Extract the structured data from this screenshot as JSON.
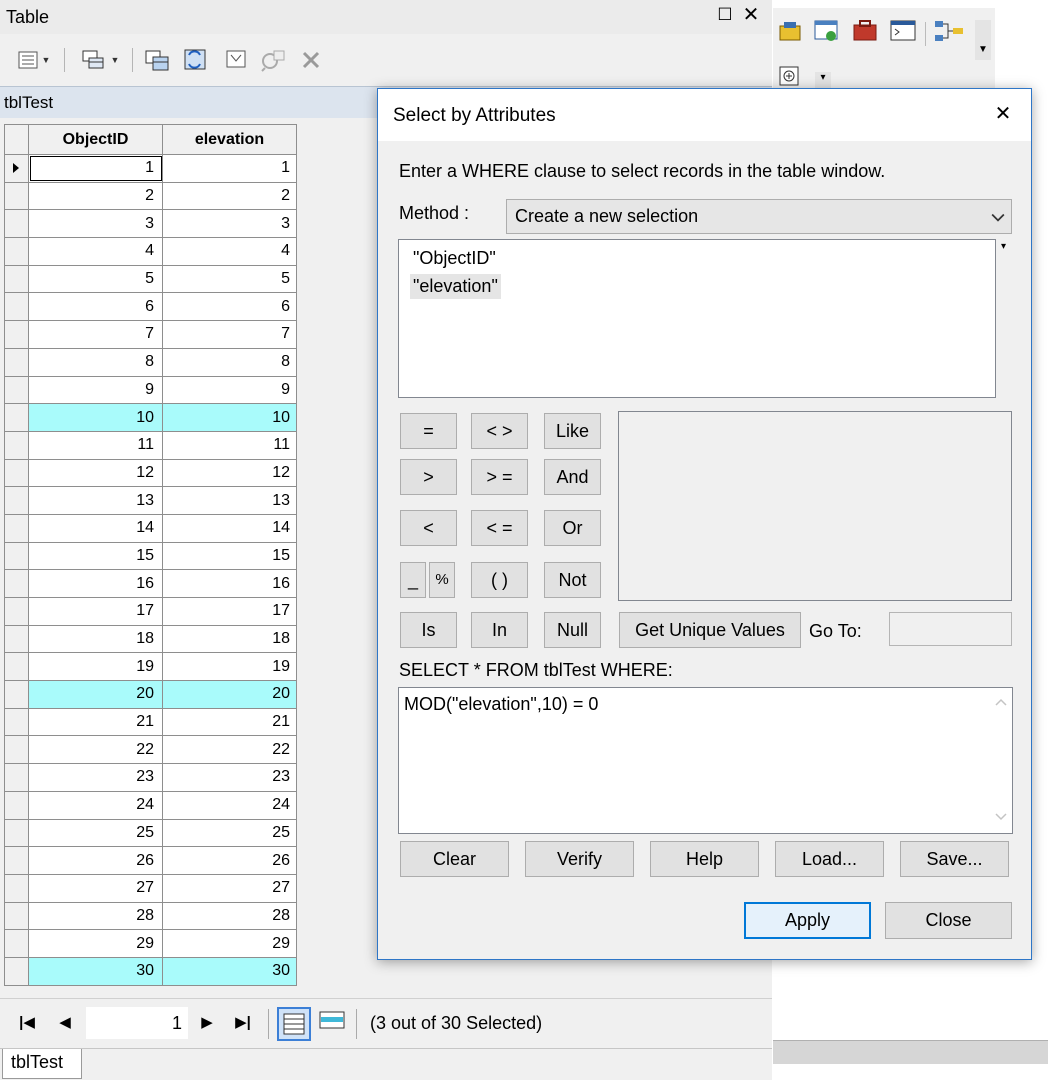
{
  "table_window": {
    "title": "Table",
    "table_name": "tblTest",
    "columns": [
      "ObjectID",
      "elevation"
    ],
    "rows": [
      {
        "objectid": "1",
        "elevation": "1"
      },
      {
        "objectid": "2",
        "elevation": "2"
      },
      {
        "objectid": "3",
        "elevation": "3"
      },
      {
        "objectid": "4",
        "elevation": "4"
      },
      {
        "objectid": "5",
        "elevation": "5"
      },
      {
        "objectid": "6",
        "elevation": "6"
      },
      {
        "objectid": "7",
        "elevation": "7"
      },
      {
        "objectid": "8",
        "elevation": "8"
      },
      {
        "objectid": "9",
        "elevation": "9"
      },
      {
        "objectid": "10",
        "elevation": "10"
      },
      {
        "objectid": "11",
        "elevation": "11"
      },
      {
        "objectid": "12",
        "elevation": "12"
      },
      {
        "objectid": "13",
        "elevation": "13"
      },
      {
        "objectid": "14",
        "elevation": "14"
      },
      {
        "objectid": "15",
        "elevation": "15"
      },
      {
        "objectid": "16",
        "elevation": "16"
      },
      {
        "objectid": "17",
        "elevation": "17"
      },
      {
        "objectid": "18",
        "elevation": "18"
      },
      {
        "objectid": "19",
        "elevation": "19"
      },
      {
        "objectid": "20",
        "elevation": "20"
      },
      {
        "objectid": "21",
        "elevation": "21"
      },
      {
        "objectid": "22",
        "elevation": "22"
      },
      {
        "objectid": "23",
        "elevation": "23"
      },
      {
        "objectid": "24",
        "elevation": "24"
      },
      {
        "objectid": "25",
        "elevation": "25"
      },
      {
        "objectid": "26",
        "elevation": "26"
      },
      {
        "objectid": "27",
        "elevation": "27"
      },
      {
        "objectid": "28",
        "elevation": "28"
      },
      {
        "objectid": "29",
        "elevation": "29"
      },
      {
        "objectid": "30",
        "elevation": "30"
      }
    ],
    "selected_rows": [
      "10",
      "20",
      "30"
    ],
    "current_row": "1",
    "current_record": "1",
    "selection_summary": "(3 out of 30 Selected)",
    "bottom_tab": "tblTest",
    "selection_color": "#a9fbfb",
    "toolbar_icons": [
      "table-options-icon",
      "related-tables-icon",
      "select-by-attributes-icon",
      "switch-selection-icon",
      "clear-selection-icon",
      "zoom-to-selected-icon",
      "delete-selected-icon"
    ]
  },
  "dialog": {
    "title": "Select by Attributes",
    "instruction": "Enter a WHERE clause to select records in the table window.",
    "method_label": "Method :",
    "method_value": "Create a new selection",
    "fields": [
      "\"ObjectID\"",
      "\"elevation\""
    ],
    "operators": {
      "eq": "=",
      "ne": "< >",
      "like": "Like",
      "gt": ">",
      "ge": "> =",
      "and": "And",
      "lt": "<",
      "le": "< =",
      "or": "Or",
      "underscore": "_",
      "percent": "%",
      "parens": "( )",
      "not": "Not",
      "is": "Is",
      "in": "In",
      "null": "Null"
    },
    "get_unique_values": "Get Unique Values",
    "goto_label": "Go To:",
    "goto_value": "",
    "sql_prefix": "SELECT * FROM tblTest WHERE:",
    "expression": "MOD(\"elevation\",10) = 0",
    "buttons": {
      "clear": "Clear",
      "verify": "Verify",
      "help": "Help",
      "load": "Load...",
      "save": "Save..."
    },
    "apply": "Apply",
    "close": "Close",
    "accent_color": "#0078d7"
  }
}
